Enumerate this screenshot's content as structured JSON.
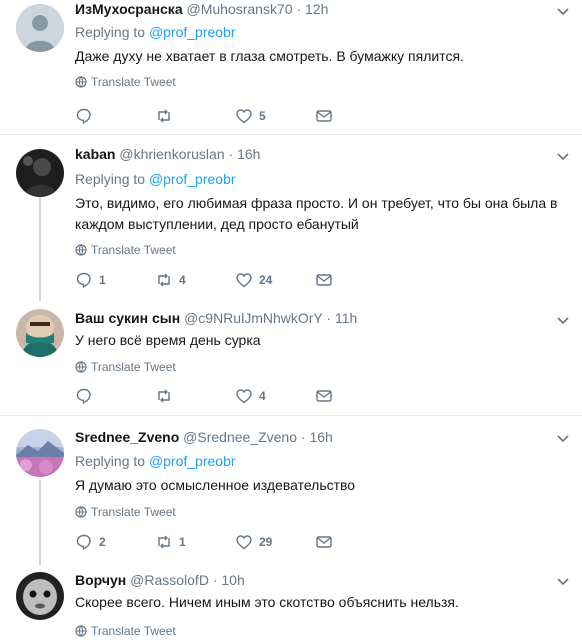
{
  "tweets": [
    {
      "name": "ИзМухосранска",
      "handle": "@Muhosransk70",
      "time": "12h",
      "reply_prefix": "Replying to",
      "reply_to": "@prof_preobr",
      "text": "Даже духу не хватает в глаза смотреть. В бумажку пялится.",
      "translate": "Translate Tweet",
      "replies": "",
      "retweets": "",
      "likes": "5",
      "avatar": "default-avatar"
    },
    {
      "name": "kaban",
      "handle": "@khrienkoruslan",
      "time": "16h",
      "reply_prefix": "Replying to",
      "reply_to": "@prof_preobr",
      "text": "Это, видимо, его любимая фраза просто. И он требует, что бы она была в каждом выступлении, дед просто ебанутый",
      "translate": "Translate Tweet",
      "replies": "1",
      "retweets": "4",
      "likes": "24",
      "avatar": "dark-portrait"
    },
    {
      "name": "Ваш сукин сын",
      "handle": "@c9NRulJmNhwkOrY",
      "time": "11h",
      "text": "У него всё время день сурка",
      "translate": "Translate Tweet",
      "replies": "",
      "retweets": "",
      "likes": "4",
      "avatar": "masked-face"
    },
    {
      "name": "Srednee_Zveno",
      "handle": "@Srednee_Zveno",
      "time": "16h",
      "reply_prefix": "Replying to",
      "reply_to": "@prof_preobr",
      "text": "Я думаю это осмысленное издевательство",
      "translate": "Translate Tweet",
      "replies": "2",
      "retweets": "1",
      "likes": "29",
      "avatar": "landscape"
    },
    {
      "name": "Ворчун",
      "handle": "@RassolofD",
      "time": "10h",
      "text": "Скорее всего. Ничем иным это скотство объяснить нельзя.",
      "translate": "Translate Tweet",
      "avatar": "bw-face"
    }
  ],
  "colors": {
    "accent": "#1da1f2",
    "muted": "#657786",
    "text": "#14171a",
    "border": "#e6ecf0"
  }
}
